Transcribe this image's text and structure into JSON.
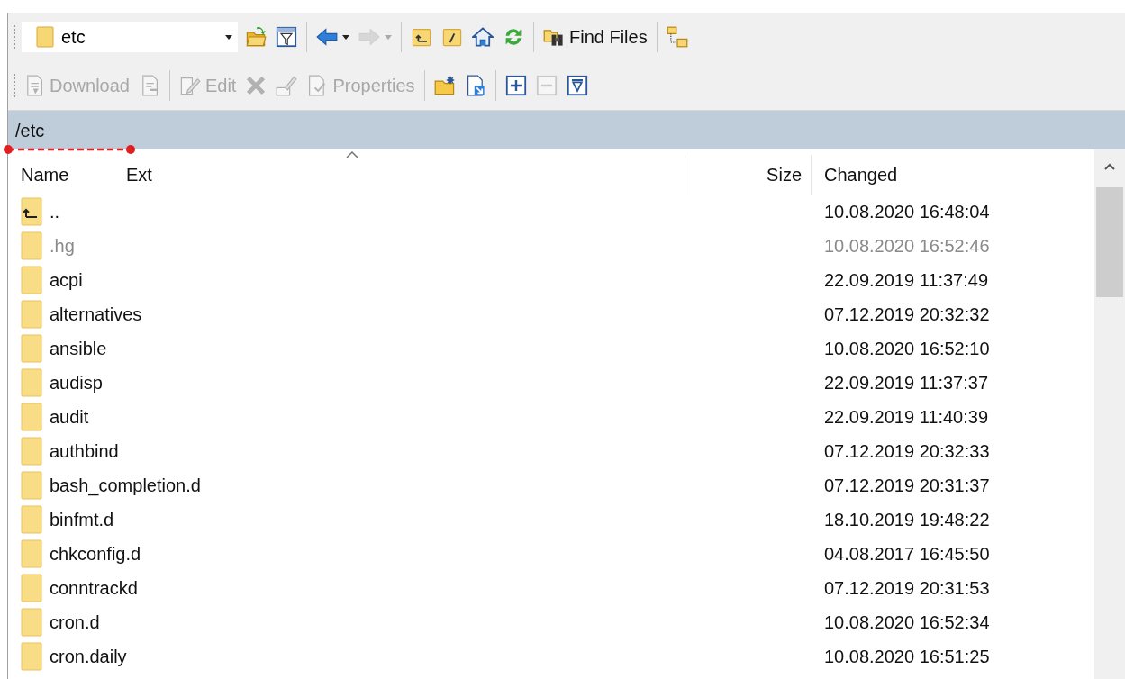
{
  "toolbars": [
    [
      {
        "kind": "address",
        "value": "etc"
      },
      {
        "kind": "button",
        "disabled": false
      },
      {
        "kind": "button",
        "disabled": false
      },
      {
        "kind": "separator"
      },
      {
        "kind": "button",
        "disabled": false,
        "dropdown": true
      },
      {
        "kind": "button",
        "disabled": true,
        "dropdown": true
      },
      {
        "kind": "separator"
      },
      {
        "kind": "button",
        "disabled": false
      },
      {
        "kind": "button",
        "disabled": false
      },
      {
        "kind": "button",
        "disabled": false
      },
      {
        "kind": "button",
        "disabled": false
      },
      {
        "kind": "separator"
      },
      {
        "kind": "button",
        "label": "Find Files",
        "disabled": false
      },
      {
        "kind": "separator"
      },
      {
        "kind": "button",
        "disabled": false
      }
    ],
    [
      {
        "kind": "button",
        "label": "Download",
        "disabled": true
      },
      {
        "kind": "button",
        "disabled": true
      },
      {
        "kind": "separator"
      },
      {
        "kind": "button",
        "label": "Edit",
        "disabled": true
      },
      {
        "kind": "button",
        "disabled": true
      },
      {
        "kind": "button",
        "disabled": true
      },
      {
        "kind": "button",
        "label": "Properties",
        "disabled": true
      },
      {
        "kind": "separator"
      },
      {
        "kind": "button",
        "disabled": false
      },
      {
        "kind": "button",
        "disabled": false
      },
      {
        "kind": "separator"
      },
      {
        "kind": "button",
        "disabled": false
      },
      {
        "kind": "button",
        "disabled": true
      },
      {
        "kind": "button",
        "disabled": false
      }
    ]
  ],
  "path": "/etc",
  "table": {
    "columns": [
      {
        "label": "Name",
        "sorted": true
      },
      {
        "label": "Ext",
        "sorted": false
      },
      {
        "label": "Size",
        "sorted": false
      },
      {
        "label": "Changed",
        "sorted": false
      }
    ],
    "rows": [
      {
        "kind": "parent",
        "name": "..",
        "changed": "10.08.2020 16:48:04",
        "hidden": false
      },
      {
        "kind": "folder",
        "name": ".hg",
        "changed": "10.08.2020 16:52:46",
        "hidden": true
      },
      {
        "kind": "folder",
        "name": "acpi",
        "changed": "22.09.2019 11:37:49",
        "hidden": false
      },
      {
        "kind": "folder",
        "name": "alternatives",
        "changed": "07.12.2019 20:32:32",
        "hidden": false
      },
      {
        "kind": "folder",
        "name": "ansible",
        "changed": "10.08.2020 16:52:10",
        "hidden": false
      },
      {
        "kind": "folder",
        "name": "audisp",
        "changed": "22.09.2019 11:37:37",
        "hidden": false
      },
      {
        "kind": "folder",
        "name": "audit",
        "changed": "22.09.2019 11:40:39",
        "hidden": false
      },
      {
        "kind": "folder",
        "name": "authbind",
        "changed": "07.12.2019 20:32:33",
        "hidden": false
      },
      {
        "kind": "folder",
        "name": "bash_completion.d",
        "changed": "07.12.2019 20:31:37",
        "hidden": false
      },
      {
        "kind": "folder",
        "name": "binfmt.d",
        "changed": "18.10.2019 19:48:22",
        "hidden": false
      },
      {
        "kind": "folder",
        "name": "chkconfig.d",
        "changed": "04.08.2017 16:45:50",
        "hidden": false
      },
      {
        "kind": "folder",
        "name": "conntrackd",
        "changed": "07.12.2019 20:31:53",
        "hidden": false
      },
      {
        "kind": "folder",
        "name": "cron.d",
        "changed": "10.08.2020 16:52:34",
        "hidden": false
      },
      {
        "kind": "folder",
        "name": "cron.daily",
        "changed": "10.08.2020 16:51:25",
        "hidden": false
      }
    ]
  }
}
